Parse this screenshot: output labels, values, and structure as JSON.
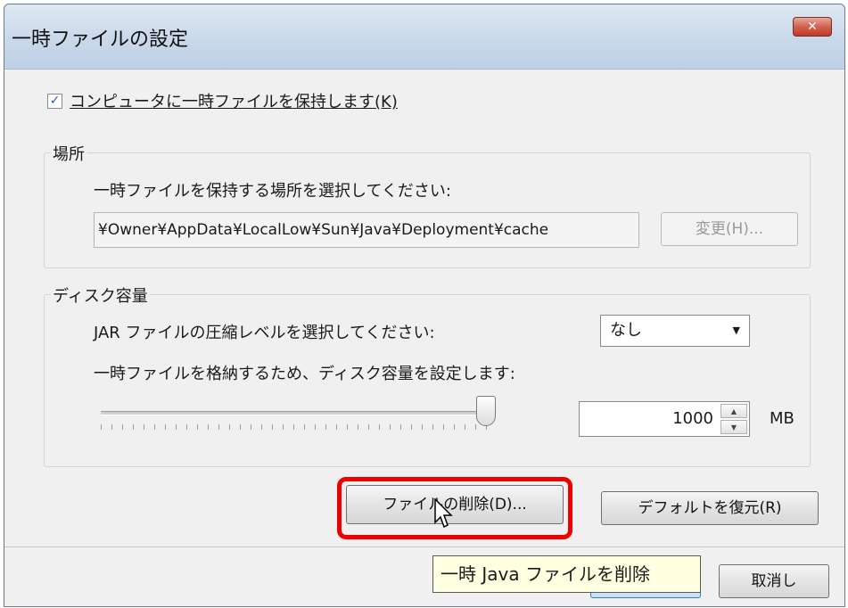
{
  "window": {
    "title": "一時ファイルの設定",
    "close_symbol": "✕"
  },
  "keep_files": {
    "checked": true,
    "label": "コンピュータに一時ファイルを保持します(K)"
  },
  "location": {
    "group_title": "場所",
    "instruction": "一時ファイルを保持する場所を選択してください:",
    "path_value": "¥Owner¥AppData¥LocalLow¥Sun¥Java¥Deployment¥cache",
    "change_button": "変更(H)..."
  },
  "disk": {
    "group_title": "ディスク容量",
    "compression_label": "JAR ファイルの圧縮レベルを選択してください:",
    "compression_value": "なし",
    "space_label": "一時ファイルを格納するため、ディスク容量を設定します:",
    "slider_level": 1.0,
    "size_value": "1000",
    "size_unit": "MB"
  },
  "actions": {
    "delete_files": "ファイルの削除(D)...",
    "restore_defaults": "デフォルトを復元(R)"
  },
  "footer": {
    "cancel": "取消し"
  },
  "tooltip": {
    "text": "一時 Java ファイルを削除"
  },
  "colors": {
    "highlight": "#ee0000",
    "tooltip_bg": "#ffffe1",
    "dialog_bg": "#f0f0f0"
  }
}
